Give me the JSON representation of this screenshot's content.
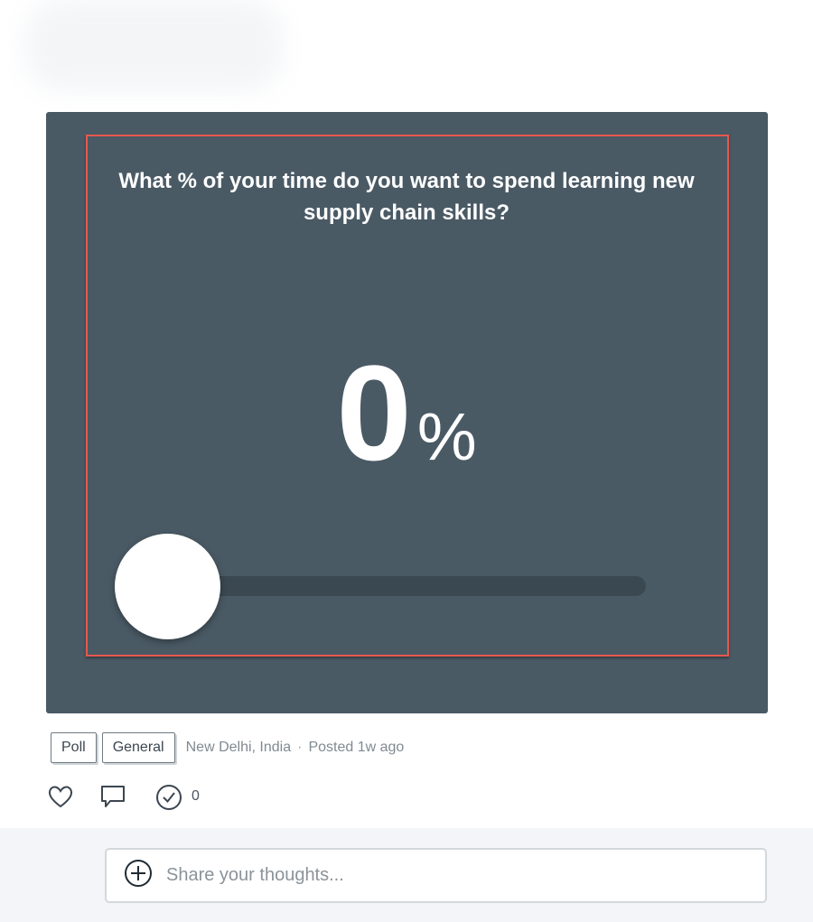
{
  "poll": {
    "question": "What % of your time do you want to spend learning new supply chain skills?",
    "value": "0",
    "unit": "%",
    "slider_level": 0
  },
  "meta": {
    "tags": [
      "Poll",
      "General"
    ],
    "location": "New Delhi, India",
    "separator": "·",
    "posted": "Posted 1w ago"
  },
  "actions": {
    "like_icon": "heart-icon",
    "comment_icon": "comment-icon",
    "check_icon": "check-circle-icon",
    "check_count": "0"
  },
  "comment": {
    "add_icon": "plus-circle-icon",
    "placeholder": "Share your thoughts..."
  },
  "colors": {
    "card_bg": "#4a5a65",
    "frame_border": "#e8584d",
    "track": "#3a4851"
  }
}
